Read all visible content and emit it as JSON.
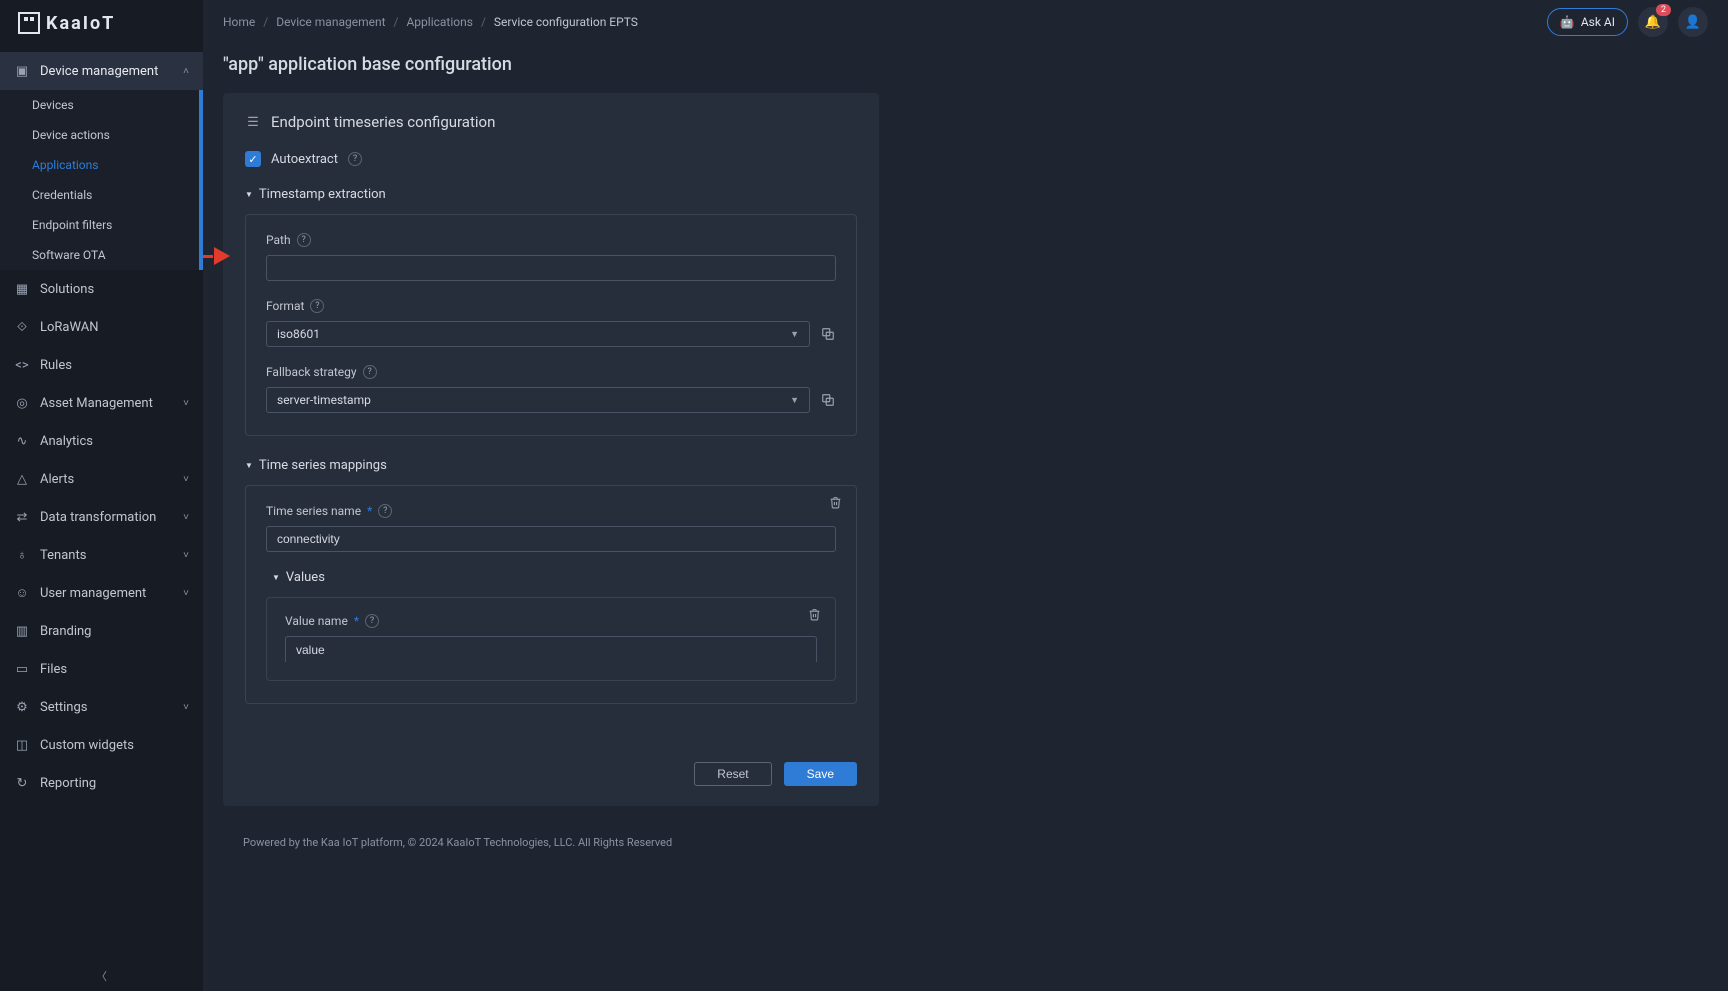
{
  "brand": "KaaIoT",
  "breadcrumbs": [
    "Home",
    "Device management",
    "Applications",
    "Service configuration EPTS"
  ],
  "header": {
    "ask_ai": "Ask AI",
    "notif_badge": "2"
  },
  "sidebar": {
    "device_management": "Device management",
    "sub": {
      "devices": "Devices",
      "device_actions": "Device actions",
      "applications": "Applications",
      "credentials": "Credentials",
      "endpoint_filters": "Endpoint filters",
      "software_ota": "Software OTA"
    },
    "solutions": "Solutions",
    "lorawan": "LoRaWAN",
    "rules": "Rules",
    "asset_management": "Asset Management",
    "analytics": "Analytics",
    "alerts": "Alerts",
    "data_transformation": "Data transformation",
    "tenants": "Tenants",
    "user_management": "User management",
    "branding": "Branding",
    "files": "Files",
    "settings": "Settings",
    "custom_widgets": "Custom widgets",
    "reporting": "Reporting"
  },
  "page": {
    "title": "\"app\" application base configuration",
    "card_title": "Endpoint timeseries configuration",
    "autoextract_label": "Autoextract",
    "timestamp_section": "Timestamp extraction",
    "path_label": "Path",
    "path_value": "",
    "format_label": "Format",
    "format_value": "iso8601",
    "fallback_label": "Fallback strategy",
    "fallback_value": "server-timestamp",
    "mappings_section": "Time series mappings",
    "ts_name_label": "Time series name",
    "ts_name_value": "connectivity",
    "values_section": "Values",
    "value_name_label": "Value name",
    "value_name_value": "value",
    "reset": "Reset",
    "save": "Save"
  },
  "footer": "Powered by the Kaa IoT platform, © 2024 KaaIoT Technologies, LLC. All Rights Reserved"
}
